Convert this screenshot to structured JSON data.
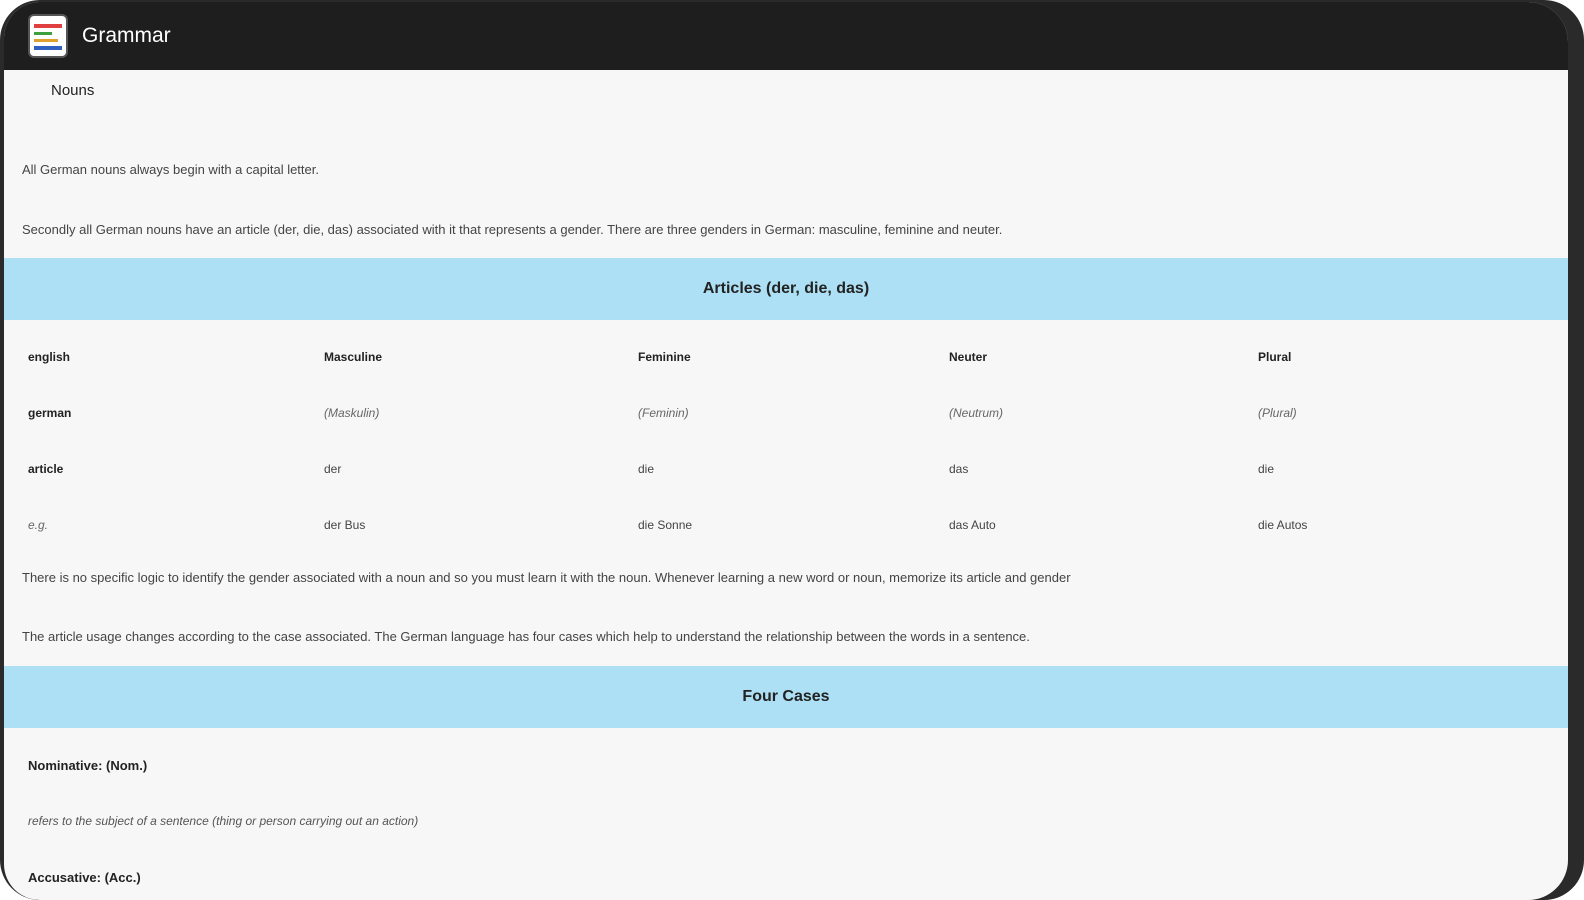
{
  "appbar": {
    "title": "Grammar",
    "icon": "grammar-app-icon"
  },
  "page": {
    "section_label": "Nouns",
    "intro": [
      "All German nouns always begin with a capital letter.",
      "Secondly all German nouns have an article (der, die, das) associated with it that represents a gender. There are three genders in German: masculine, feminine and neuter."
    ],
    "articles_heading": "Articles (der, die, das)",
    "articles_table": {
      "rows": [
        {
          "label": "english",
          "cells": [
            "Masculine",
            "Feminine",
            "Neuter",
            "Plural"
          ]
        },
        {
          "label": "german",
          "cells": [
            "(Maskulin)",
            "(Feminin)",
            "(Neutrum)",
            "(Plural)"
          ]
        },
        {
          "label": "article",
          "cells": [
            "der",
            "die",
            "das",
            "die"
          ]
        },
        {
          "label": "e.g.",
          "cells": [
            "der Bus",
            "die Sonne",
            "das Auto",
            "die Autos"
          ]
        }
      ]
    },
    "middle": [
      "There is no specific logic to identify the gender associated with a noun and so you must learn it with the noun. Whenever learning a new word or noun, memorize its article and gender",
      "The article usage changes according to the case associated.  The German language has four cases which help to understand the relationship between the words in a sentence."
    ],
    "cases_heading": "Four Cases",
    "cases": [
      {
        "name": "Nominative: (Nom.)",
        "desc": "refers to the subject of a sentence (thing or person carrying out an action)"
      },
      {
        "name": "Accusative: (Acc.)"
      }
    ]
  },
  "colors": {
    "appbar": "#1e1e1e",
    "band": "#ade0f4",
    "background": "#f7f7f7"
  }
}
